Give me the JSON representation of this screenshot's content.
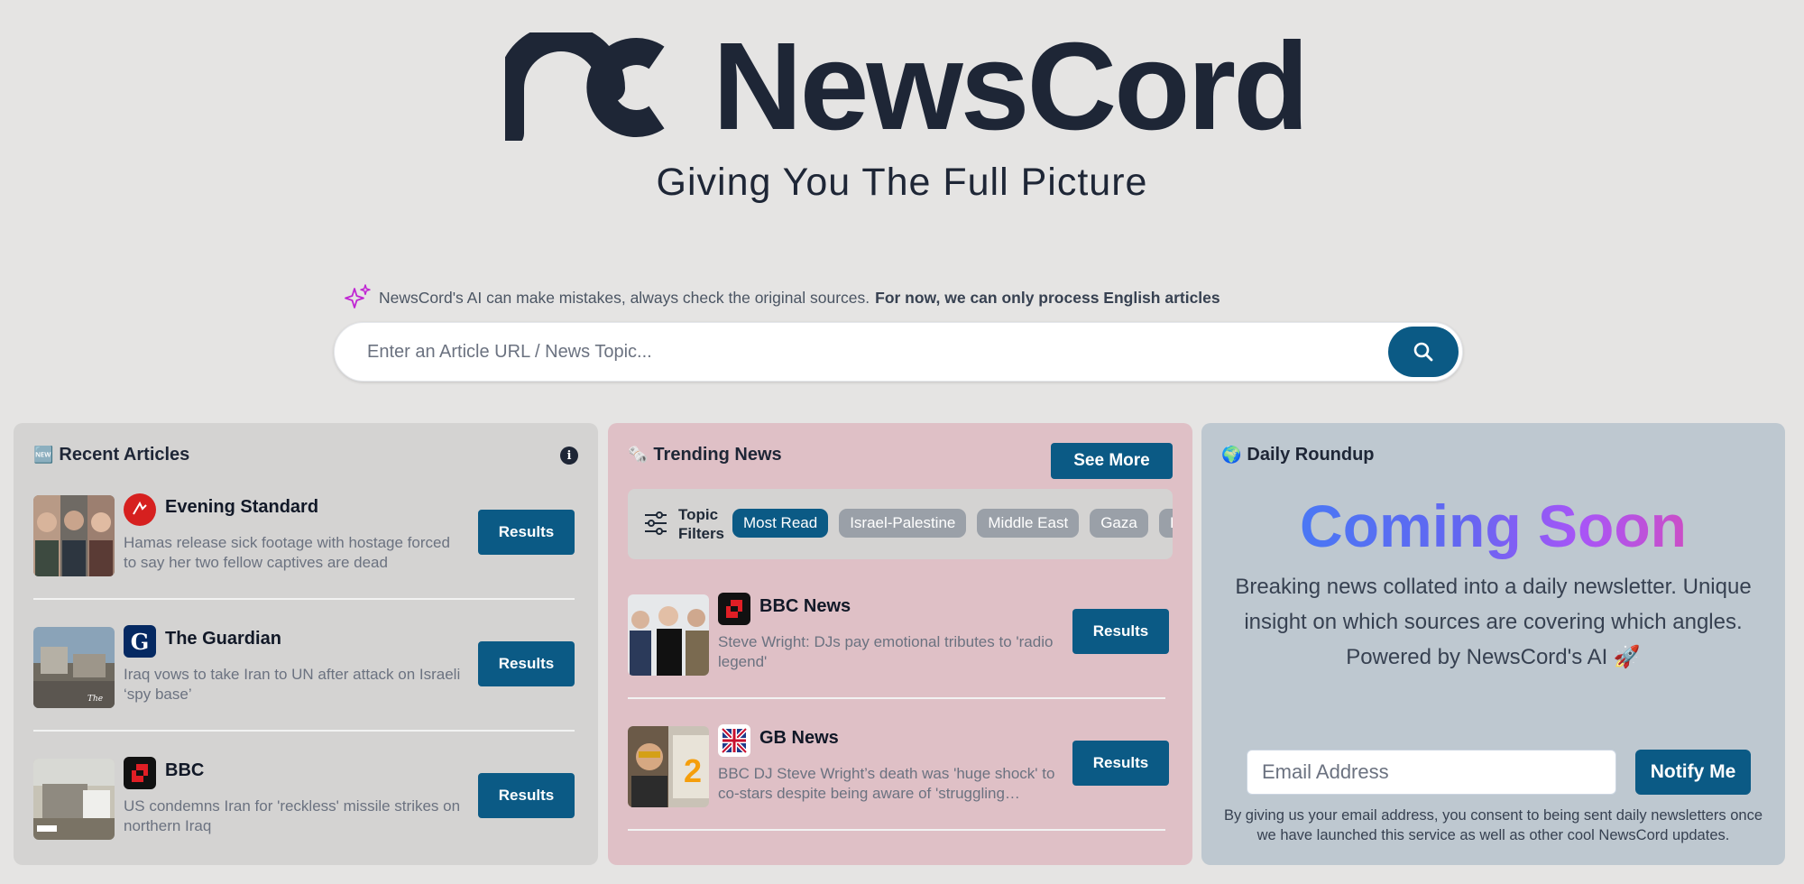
{
  "brand": {
    "name": "NewsCord",
    "tagline": "Giving You The Full Picture"
  },
  "disclaimer": {
    "text": "NewsCord's AI can make mistakes, always check the original sources.",
    "bold": "For now, we can only process English articles"
  },
  "search": {
    "placeholder": "Enter an Article URL / News Topic..."
  },
  "recent": {
    "icon": "🆕",
    "title": "Recent Articles",
    "items": [
      {
        "source": "Evening Standard",
        "headline": "Hamas release sick footage with hostage forced to say her two fellow captives are dead",
        "button": "Results"
      },
      {
        "source": "The Guardian",
        "headline": "Iraq vows to take Iran to UN after attack on Israeli ‘spy base’",
        "button": "Results"
      },
      {
        "source": "BBC",
        "headline": "US condemns Iran for 'reckless' missile strikes on northern Iraq",
        "button": "Results"
      }
    ]
  },
  "trending": {
    "icon": "🗞️",
    "title": "Trending News",
    "see_more": "See More",
    "filter_label_1": "Topic",
    "filter_label_2": "Filters",
    "chips": [
      "Most Read",
      "Israel-Palestine",
      "Middle East",
      "Gaza",
      "Iran"
    ],
    "items": [
      {
        "source": "BBC News",
        "headline": "Steve Wright: DJs pay emotional tributes to 'radio legend'",
        "button": "Results"
      },
      {
        "source": "GB News",
        "headline": "BBC DJ Steve Wright’s death was 'huge shock' to co-stars despite being aware of 'struggling…",
        "button": "Results"
      }
    ]
  },
  "daily": {
    "icon": "🌍",
    "title": "Daily Roundup",
    "coming_soon": "Coming Soon",
    "description": "Breaking news collated into a daily newsletter. Unique insight on which sources are covering which angles. Powered by NewsCord's AI 🚀",
    "email_placeholder": "Email Address",
    "notify": "Notify Me",
    "consent": "By giving us your email address, you consent to being sent daily newsletters once we have launched this service as well as other cool NewsCord updates."
  },
  "colors": {
    "primary": "#0b5a85",
    "dark": "#1e2636",
    "recent_bg": "#d4d3d2",
    "trending_bg": "#dfc0c6",
    "daily_bg": "#bec8d0"
  }
}
